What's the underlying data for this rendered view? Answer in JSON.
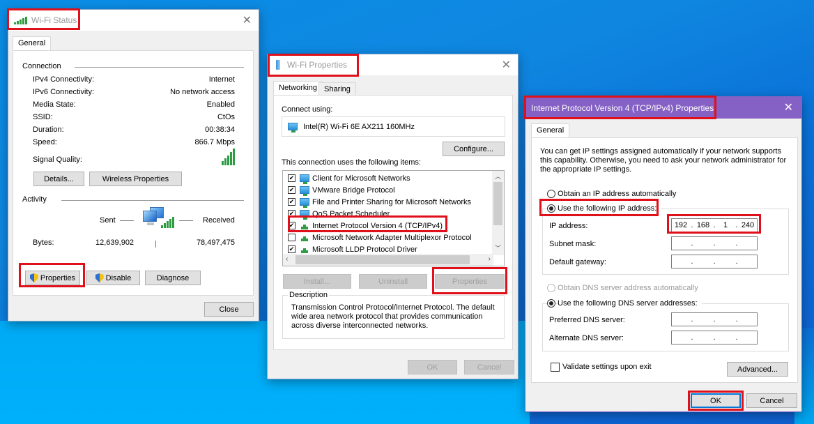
{
  "wifi_status": {
    "title": "Wi-Fi Status",
    "tab": "General",
    "connection_group": "Connection",
    "rows": [
      {
        "label": "IPv4 Connectivity:",
        "value": "Internet"
      },
      {
        "label": "IPv6 Connectivity:",
        "value": "No network access"
      },
      {
        "label": "Media State:",
        "value": "Enabled"
      },
      {
        "label": "SSID:",
        "value": "CtOs"
      },
      {
        "label": "Duration:",
        "value": "00:38:34"
      },
      {
        "label": "Speed:",
        "value": "866.7 Mbps"
      }
    ],
    "signal_label": "Signal Quality:",
    "signal_bars": 5,
    "details_button": "Details...",
    "wireless_button": "Wireless Properties",
    "activity_group": "Activity",
    "sent_label": "Sent",
    "received_label": "Received",
    "bytes_label": "Bytes:",
    "bytes_sent": "12,639,902",
    "bytes_received": "78,497,475",
    "properties_button": "Properties",
    "disable_button": "Disable",
    "diagnose_button": "Diagnose",
    "close_button": "Close"
  },
  "wifi_properties": {
    "title": "Wi-Fi Properties",
    "tabs": [
      "Networking",
      "Sharing"
    ],
    "connect_using_label": "Connect using:",
    "adapter": "Intel(R) Wi-Fi 6E AX211 160MHz",
    "configure_button": "Configure...",
    "items_label": "This connection uses the following items:",
    "items": [
      {
        "label": "Client for Microsoft Networks",
        "checked": true,
        "icon": "monitor"
      },
      {
        "label": "VMware Bridge Protocol",
        "checked": true,
        "icon": "monitor"
      },
      {
        "label": "File and Printer Sharing for Microsoft Networks",
        "checked": true,
        "icon": "monitor"
      },
      {
        "label": "QoS Packet Scheduler",
        "checked": true,
        "icon": "monitor"
      },
      {
        "label": "Internet Protocol Version 4 (TCP/IPv4)",
        "checked": true,
        "icon": "protocol"
      },
      {
        "label": "Microsoft Network Adapter Multiplexor Protocol",
        "checked": false,
        "icon": "protocol"
      },
      {
        "label": "Microsoft LLDP Protocol Driver",
        "checked": true,
        "icon": "protocol"
      }
    ],
    "install_button": "Install...",
    "uninstall_button": "Uninstall",
    "properties_button": "Properties",
    "description_label": "Description",
    "description_text": "Transmission Control Protocol/Internet Protocol. The default wide area network protocol that provides communication across diverse interconnected networks.",
    "ok_button": "OK",
    "cancel_button": "Cancel"
  },
  "ipv4": {
    "title": "Internet Protocol Version 4 (TCP/IPv4) Properties",
    "title_bar_color": "#8661c5",
    "tab": "General",
    "intro": "You can get IP settings assigned automatically if your network supports this capability. Otherwise, you need to ask your network administrator for the appropriate IP settings.",
    "obtain_ip_auto": "Obtain an IP address automatically",
    "use_following_ip": "Use the following IP address:",
    "ip_address_label": "IP address:",
    "ip_address": [
      "192",
      "168",
      "1",
      "240"
    ],
    "subnet_mask_label": "Subnet mask:",
    "subnet_mask": [
      "",
      "",
      "",
      ""
    ],
    "default_gateway_label": "Default gateway:",
    "default_gateway": [
      "",
      "",
      "",
      ""
    ],
    "obtain_dns_auto": "Obtain DNS server address automatically",
    "use_following_dns": "Use the following DNS server addresses:",
    "preferred_dns_label": "Preferred DNS server:",
    "preferred_dns": [
      "",
      "",
      "",
      ""
    ],
    "alternate_dns_label": "Alternate DNS server:",
    "alternate_dns": [
      "",
      "",
      "",
      ""
    ],
    "validate_label": "Validate settings upon exit",
    "advanced_button": "Advanced...",
    "ok_button": "OK",
    "cancel_button": "Cancel"
  },
  "highlight_color": "#e0101a"
}
